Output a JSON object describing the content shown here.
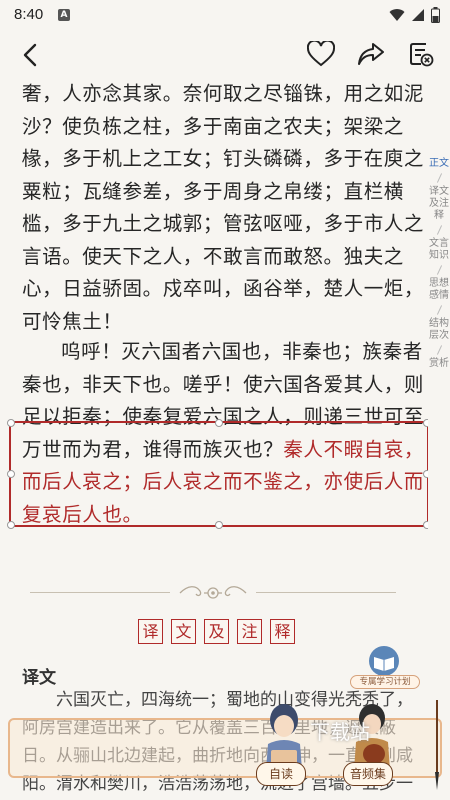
{
  "status": {
    "time": "8:40",
    "notif_icon": "A"
  },
  "header": {
    "icons": [
      "heart-icon",
      "share-icon",
      "close-notes-icon"
    ]
  },
  "main": {
    "paragraph1": "奢，人亦念其家。奈何取之尽锱铢，用之如泥沙？使负栋之柱，多于南亩之农夫；架梁之椽，多于机上之工女；钉头磷磷，多于在庾之粟粒；瓦缝参差，多于周身之帛缕；直栏横槛，多于九土之城郭；管弦呕哑，多于市人之言语。使天下之人，不敢言而敢怒。独夫之心，日益骄固。戍卒叫，函谷举，楚人一炬，可怜焦土！",
    "paragraph2_normal": "呜呼！灭六国者六国也，非秦也；族秦者秦也，非天下也。嗟乎！使六国各爱其人，则足以拒秦；使秦复爱六国之人，则递三世可至万世而为君，谁得而族灭也？",
    "paragraph2_red": "秦人不暇自哀，而后人哀之；后人哀之而不鉴之，亦使后人而复哀后人也。",
    "section_title": [
      "译",
      "文",
      "及",
      "注",
      "释"
    ],
    "yiwen_heading": "译文",
    "yiwen_text": "六国灭亡，四海统一；蜀地的山变得光秃秃了，阿房宫建造出来了。它从覆盖三百多里地，遮天蔽日。从骊山北边建起，曲折地向西延伸，一直通到咸阳。渭水和樊川，浩浩荡荡地，流进了宫墙。五步一座楼，十步一个阁，走"
  },
  "sidenav": [
    "正文",
    "译文及注释",
    "文言知识",
    "思想感情",
    "结构层次",
    "赏析"
  ],
  "badges": {
    "plan": "专属学习计划",
    "self_read": "自读",
    "audio": "音频集",
    "watermark": "下载站"
  },
  "colors": {
    "accent_red": "#b02a2a",
    "nav_active": "#3b6db5",
    "brown": "#6a3b1d"
  }
}
